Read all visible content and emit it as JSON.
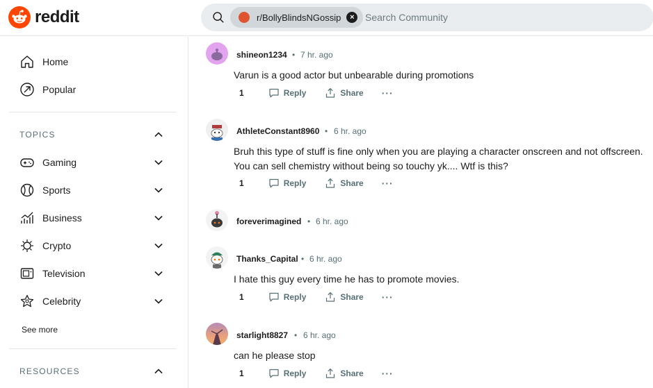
{
  "header": {
    "logo_text": "reddit",
    "search_chip": "r/BollyBlindsNGossip",
    "chip_close": "×",
    "search_placeholder": "Search Community"
  },
  "sidebar": {
    "primary": [
      {
        "label": "Home",
        "icon": "home-icon"
      },
      {
        "label": "Popular",
        "icon": "popular-icon"
      }
    ],
    "topics_heading": "TOPICS",
    "topics": [
      {
        "label": "Gaming",
        "icon": "gaming-icon"
      },
      {
        "label": "Sports",
        "icon": "sports-icon"
      },
      {
        "label": "Business",
        "icon": "business-icon"
      },
      {
        "label": "Crypto",
        "icon": "crypto-icon"
      },
      {
        "label": "Television",
        "icon": "television-icon"
      },
      {
        "label": "Celebrity",
        "icon": "celebrity-icon"
      }
    ],
    "see_more": "See more",
    "resources_heading": "RESOURCES"
  },
  "comments": [
    {
      "user": "shineon1234",
      "dot": "•",
      "time": "7 hr. ago",
      "body": "Varun is a good actor but unbearable during promotions",
      "votes": "1",
      "reply": "Reply",
      "share": "Share",
      "more": "···"
    },
    {
      "user": "AthleteConstant8960",
      "dot": "•",
      "time": "6 hr. ago",
      "body": "Bruh this type of stuff is fine only when you are playing a character onscreen and not offscreen. You can sell chemistry without being so touchy yk.... Wtf is this?",
      "votes": "1",
      "reply": "Reply",
      "share": "Share",
      "more": "···"
    },
    {
      "user": "foreverimagined",
      "dot": "•",
      "time": "6 hr. ago"
    },
    {
      "user": "Thanks_Capital",
      "dot": "•",
      "time": "6 hr. ago",
      "body": "I hate this guy every time he has to promote movies.",
      "votes": "1",
      "reply": "Reply",
      "share": "Share",
      "more": "···"
    },
    {
      "user": "starlight8827",
      "dot": "•",
      "time": "6 hr. ago",
      "body": "can he please stop",
      "votes": "1",
      "reply": "Reply",
      "share": "Share",
      "more": "···"
    }
  ],
  "colors": {
    "brand": "#ff4500",
    "muted": "#576f76",
    "search_bg": "#eaedef"
  }
}
